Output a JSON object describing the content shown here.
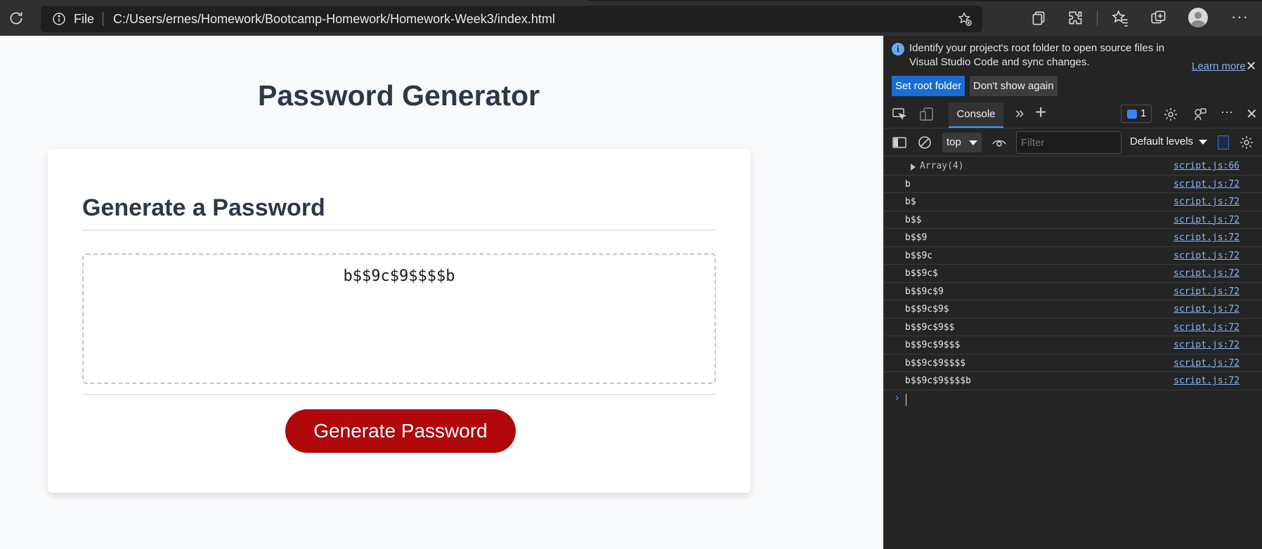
{
  "browser": {
    "address": {
      "scheme_label": "File",
      "url": "C:/Users/ernes/Homework/Bootcamp-Homework/Homework-Week3/index.html"
    },
    "icons": [
      "reload-icon",
      "site-info-icon",
      "add-favorite-icon",
      "collections-icon",
      "extensions-icon",
      "favorites-icon",
      "collections-add-icon",
      "profile-avatar",
      "settings-more-icon"
    ],
    "more_label": "···"
  },
  "page": {
    "title": "Password Generator",
    "card_title": "Generate a Password",
    "password_value": "b$$9c$9$$$$b",
    "generate_button": "Generate Password"
  },
  "devtools": {
    "infobar": {
      "icon_label": "i",
      "message": "Identify your project's root folder to open source files in Visual Studio Code and sync changes.",
      "learn_more": "Learn more",
      "close": "✕",
      "primary_button": "Set root folder",
      "secondary_button": "Don't show again"
    },
    "tabs": {
      "active": "Console",
      "more_tabs": "»",
      "add_tab": "+",
      "issues_count": "1",
      "more": "···",
      "close": "✕"
    },
    "filterbar": {
      "context": "top",
      "filter_placeholder": "Filter",
      "levels": "Default levels"
    },
    "logs": [
      {
        "text": "Array(4)",
        "source": "script.js:66",
        "expandable": true
      },
      {
        "text": "b",
        "source": "script.js:72"
      },
      {
        "text": "b$",
        "source": "script.js:72"
      },
      {
        "text": "b$$",
        "source": "script.js:72"
      },
      {
        "text": "b$$9",
        "source": "script.js:72"
      },
      {
        "text": "b$$9c",
        "source": "script.js:72"
      },
      {
        "text": "b$$9c$",
        "source": "script.js:72"
      },
      {
        "text": "b$$9c$9",
        "source": "script.js:72"
      },
      {
        "text": "b$$9c$9$",
        "source": "script.js:72"
      },
      {
        "text": "b$$9c$9$$",
        "source": "script.js:72"
      },
      {
        "text": "b$$9c$9$$$",
        "source": "script.js:72"
      },
      {
        "text": "b$$9c$9$$$$",
        "source": "script.js:72"
      },
      {
        "text": "b$$9c$9$$$$b",
        "source": "script.js:72"
      }
    ],
    "prompt_symbol": "›"
  },
  "colors": {
    "brand_button": "#b0080b",
    "devtools_accent": "#4a9cf5",
    "link": "#8ab4f8"
  }
}
